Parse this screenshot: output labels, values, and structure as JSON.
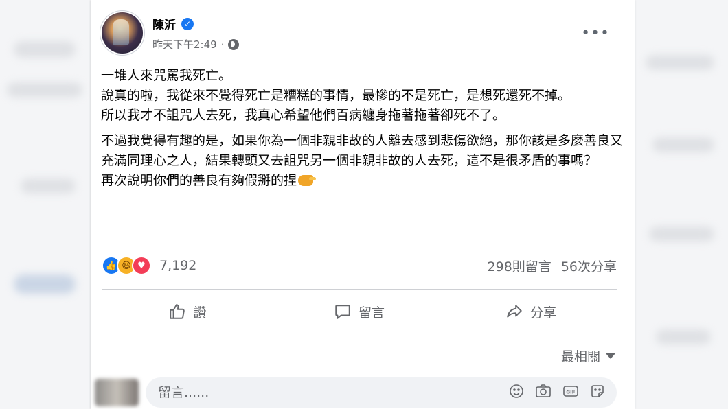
{
  "post": {
    "author": "陳沂",
    "time": "昨天下午2:49",
    "paragraphs": [
      "一堆人來咒罵我死亡。",
      "說真的啦，我從來不覺得死亡是糟糕的事情，最慘的不是死亡，是想死還死不掉。",
      "所以我才不詛咒人去死，我真心希望他們百病纏身拖著拖著卻死不了。"
    ],
    "paragraphs2": [
      "不過我覺得有趣的是，如果你為一個非親非故的人離去感到悲傷欲絕，那你該是多麼善良又充滿同理心之人，結果轉頭又去詛咒另一個非親非故的人去死，這不是很矛盾的事嗎？",
      "再次說明你們的善良有夠假掰的捏"
    ],
    "reaction_count": "7,192",
    "comment_count": "298則留言",
    "share_count": "56次分享"
  },
  "actions": {
    "like": "讚",
    "comment": "留言",
    "share": "分享"
  },
  "sort_label": "最相關",
  "comment_placeholder": "留言......",
  "colors": {
    "accent": "#1877f2",
    "secondary_text": "#65676b"
  },
  "icons": {
    "reactions": [
      "like-reaction-icon",
      "haha-reaction-icon",
      "love-reaction-icon"
    ],
    "composer": [
      "emoji-icon",
      "camera-icon",
      "gif-icon",
      "sticker-icon"
    ]
  }
}
